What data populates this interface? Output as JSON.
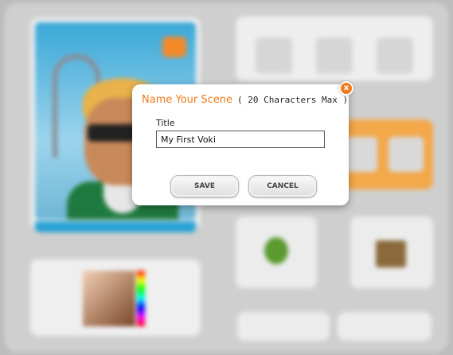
{
  "dialog": {
    "title": "Name Your Scene",
    "subtitle": "( 20 Characters Max )",
    "close_glyph": "x",
    "field_label": "Title",
    "title_value": "My First Voki",
    "save_label": "SAVE",
    "cancel_label": "CANCEL"
  },
  "colors": {
    "accent": "#f07a1a",
    "preview_border": "#35c6ef",
    "background": "#bdbdbd"
  },
  "icons": [
    "close-icon",
    "speech-bubble-icon",
    "person-icon",
    "shirt-icon",
    "sunglasses-icon",
    "brush-icon",
    "folder-icon",
    "tree-icon",
    "picture-icon"
  ]
}
